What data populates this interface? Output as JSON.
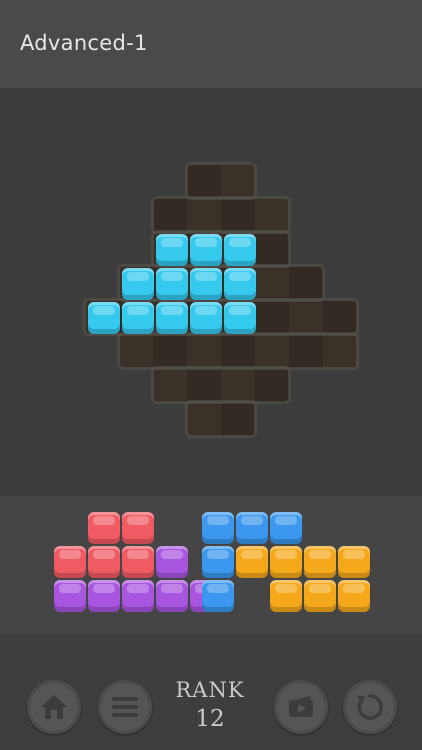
{
  "header": {
    "title": "Advanced-1"
  },
  "rank": {
    "label": "RANK",
    "value": "12"
  },
  "toolbar": {
    "home": {
      "icon": "home-icon"
    },
    "menu": {
      "icon": "menu-icon"
    },
    "video": {
      "icon": "video-icon"
    },
    "restart": {
      "icon": "restart-icon"
    }
  },
  "colors": {
    "cyan": "#35c9ee",
    "red": "#ef5a63",
    "purple": "#a855e0",
    "blue": "#3b98ee",
    "orange": "#f5a81a",
    "board": "#3a3129"
  },
  "board": {
    "rows": [
      "...XX....",
      "..XXXX...",
      "..XXXX...",
      ".XXXXXX..",
      "XXXXXXXX.",
      ".XXXXXXX.",
      "..XXXX...",
      "...XX...."
    ]
  },
  "pieces": {
    "placed": [
      {
        "color": "cyan",
        "cells": [
          [
            2,
            2
          ],
          [
            3,
            2
          ],
          [
            4,
            2
          ],
          [
            1,
            3
          ],
          [
            2,
            3
          ],
          [
            3,
            3
          ],
          [
            4,
            3
          ],
          [
            0,
            4
          ],
          [
            1,
            4
          ],
          [
            2,
            4
          ],
          [
            3,
            4
          ],
          [
            4,
            4
          ]
        ]
      }
    ],
    "tray": [
      {
        "color": "red",
        "cells": [
          [
            1,
            0
          ],
          [
            2,
            0
          ],
          [
            0,
            1
          ],
          [
            1,
            1
          ],
          [
            2,
            1
          ]
        ]
      },
      {
        "color": "purple",
        "cells": [
          [
            3,
            1
          ],
          [
            0,
            2
          ],
          [
            1,
            2
          ],
          [
            2,
            2
          ],
          [
            3,
            2
          ],
          [
            4,
            2
          ]
        ]
      },
      {
        "color": "blue",
        "cells": [
          [
            0,
            0
          ],
          [
            1,
            0
          ],
          [
            2,
            0
          ],
          [
            0,
            1
          ],
          [
            0,
            2
          ]
        ]
      },
      {
        "color": "orange",
        "cells": [
          [
            1,
            1
          ],
          [
            2,
            1
          ],
          [
            3,
            1
          ],
          [
            4,
            1
          ],
          [
            2,
            2
          ],
          [
            3,
            2
          ],
          [
            4,
            2
          ]
        ]
      }
    ]
  }
}
